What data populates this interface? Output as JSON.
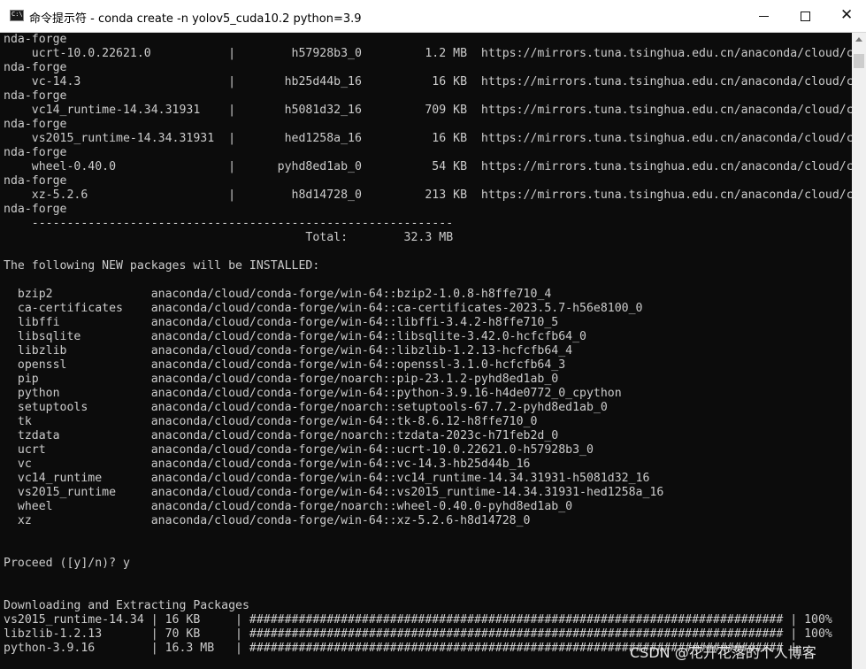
{
  "window": {
    "title": "命令提示符 - conda  create -n yolov5_cuda10.2 python=3.9",
    "icon_label": "C:\\"
  },
  "terminal": {
    "lines": [
      "nda-forge",
      "    ucrt-10.0.22621.0           |        h57928b3_0         1.2 MB  https://mirrors.tuna.tsinghua.edu.cn/anaconda/cloud/co",
      "nda-forge",
      "    vc-14.3                     |       hb25d44b_16          16 KB  https://mirrors.tuna.tsinghua.edu.cn/anaconda/cloud/co",
      "nda-forge",
      "    vc14_runtime-14.34.31931    |       h5081d32_16         709 KB  https://mirrors.tuna.tsinghua.edu.cn/anaconda/cloud/co",
      "nda-forge",
      "    vs2015_runtime-14.34.31931  |       hed1258a_16          16 KB  https://mirrors.tuna.tsinghua.edu.cn/anaconda/cloud/co",
      "nda-forge",
      "    wheel-0.40.0                |      pyhd8ed1ab_0          54 KB  https://mirrors.tuna.tsinghua.edu.cn/anaconda/cloud/co",
      "nda-forge",
      "    xz-5.2.6                    |        h8d14728_0         213 KB  https://mirrors.tuna.tsinghua.edu.cn/anaconda/cloud/co",
      "nda-forge",
      "    ------------------------------------------------------------",
      "                                           Total:        32.3 MB",
      "",
      "The following NEW packages will be INSTALLED:",
      "",
      "  bzip2              anaconda/cloud/conda-forge/win-64::bzip2-1.0.8-h8ffe710_4",
      "  ca-certificates    anaconda/cloud/conda-forge/win-64::ca-certificates-2023.5.7-h56e8100_0",
      "  libffi             anaconda/cloud/conda-forge/win-64::libffi-3.4.2-h8ffe710_5",
      "  libsqlite          anaconda/cloud/conda-forge/win-64::libsqlite-3.42.0-hcfcfb64_0",
      "  libzlib            anaconda/cloud/conda-forge/win-64::libzlib-1.2.13-hcfcfb64_4",
      "  openssl            anaconda/cloud/conda-forge/win-64::openssl-3.1.0-hcfcfb64_3",
      "  pip                anaconda/cloud/conda-forge/noarch::pip-23.1.2-pyhd8ed1ab_0",
      "  python             anaconda/cloud/conda-forge/win-64::python-3.9.16-h4de0772_0_cpython",
      "  setuptools         anaconda/cloud/conda-forge/noarch::setuptools-67.7.2-pyhd8ed1ab_0",
      "  tk                 anaconda/cloud/conda-forge/win-64::tk-8.6.12-h8ffe710_0",
      "  tzdata             anaconda/cloud/conda-forge/noarch::tzdata-2023c-h71feb2d_0",
      "  ucrt               anaconda/cloud/conda-forge/win-64::ucrt-10.0.22621.0-h57928b3_0",
      "  vc                 anaconda/cloud/conda-forge/win-64::vc-14.3-hb25d44b_16",
      "  vc14_runtime       anaconda/cloud/conda-forge/win-64::vc14_runtime-14.34.31931-h5081d32_16",
      "  vs2015_runtime     anaconda/cloud/conda-forge/win-64::vs2015_runtime-14.34.31931-hed1258a_16",
      "  wheel              anaconda/cloud/conda-forge/noarch::wheel-0.40.0-pyhd8ed1ab_0",
      "  xz                 anaconda/cloud/conda-forge/win-64::xz-5.2.6-h8d14728_0",
      "",
      "",
      "Proceed ([y]/n)? y",
      "",
      "",
      "Downloading and Extracting Packages",
      "vs2015_runtime-14.34 | 16 KB     | ############################################################################ | 100%",
      "libzlib-1.2.13       | 70 KB     | ############################################################################ | 100%",
      "python-3.9.16        | 16.3 MB   | ############################################################################ |"
    ]
  },
  "watermark": "CSDN @花开花落的个人博客",
  "colors": {
    "terminal_bg": "#0c0c0c",
    "terminal_fg": "#cccccc",
    "titlebar_bg": "#ffffff"
  }
}
